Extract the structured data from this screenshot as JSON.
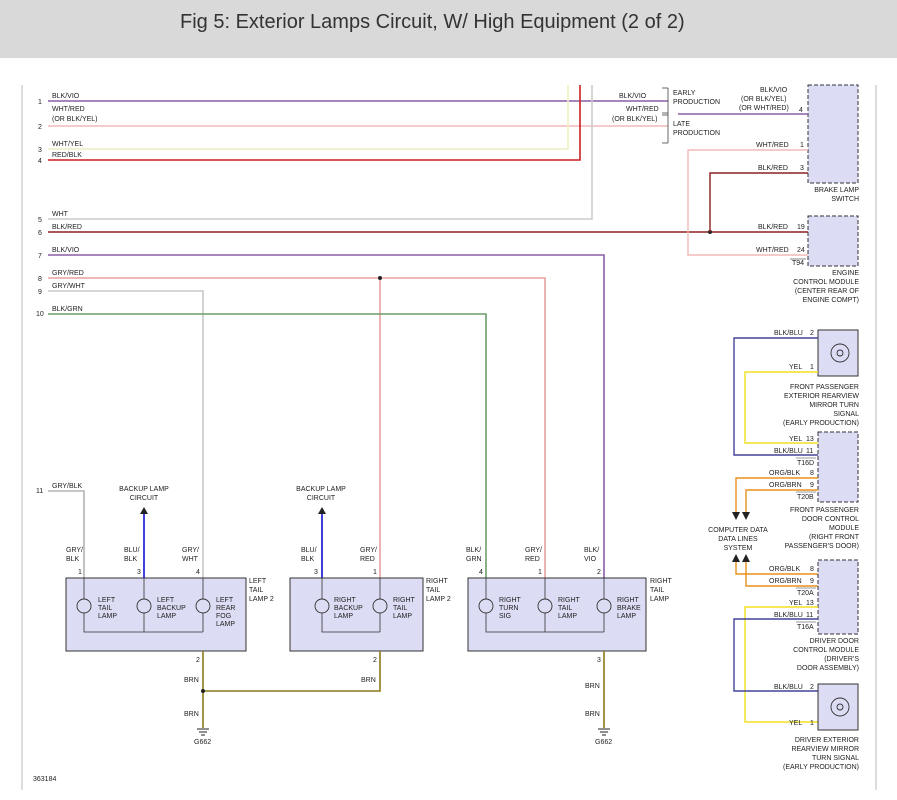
{
  "title": "Fig 5: Exterior Lamps Circuit, W/ High Equipment (2 of 2)",
  "figure_ref": "363184",
  "line_numbers": [
    "1",
    "2",
    "3",
    "4",
    "5",
    "6",
    "7",
    "8",
    "9",
    "10",
    "11"
  ],
  "wires": {
    "w1": "BLK/VIO",
    "w2a": "WHT/RED",
    "w2b": "(OR BLK/YEL)",
    "w3": "WHT/YEL",
    "w4": "RED/BLK",
    "w5": "WHT",
    "w6": "BLK/RED",
    "w7": "BLK/VIO",
    "w8": "GRY/RED",
    "w9": "GRY/WHT",
    "w10": "BLK/GRN",
    "w11": "GRY/BLK",
    "brn": "BRN"
  },
  "colors": {
    "blk_vio": "#8a5fa6",
    "wht_red": "#f2b8b8",
    "wht_yel": "#eeeec0",
    "red_blk": "#cc1f1f",
    "wht": "#cccccc",
    "blk_red": "#8b2020",
    "gry_red": "#e8a0a0",
    "gry_wht": "#c8c8c8",
    "blk_grn": "#6a9e6a",
    "gry_blk": "#b4b4b4",
    "blu_blk": "#2a2ad6",
    "brn": "#8a7a1a",
    "blk_blu": "#44449a",
    "yel": "#f0e020",
    "org": "#e8901e",
    "component_fill": "#dcdcf4"
  },
  "brake_switch": {
    "label": [
      "BRAKE LAMP",
      "SWITCH"
    ],
    "wire_a": [
      "BLK/VIO",
      "(OR BLK/YEL)",
      "(OR WHT/RED)"
    ],
    "pin_a": "4",
    "wire_b": "WHT/RED",
    "pin_b": "1",
    "wire_c": "BLK/RED",
    "pin_c": "3",
    "early": [
      "EARLY",
      "PRODUCTION"
    ],
    "late": [
      "LATE",
      "PRODUCTION"
    ],
    "early_wire": "BLK/VIO",
    "late_wire_a": "WHT/RED",
    "late_wire_b": "(OR BLK/YEL)"
  },
  "ecm": {
    "label": [
      "ENGINE",
      "CONTROL MODULE",
      "(CENTER REAR OF",
      "ENGINE COMPT)"
    ],
    "wire_a": "BLK/RED",
    "pin_a": "19",
    "wire_b": "WHT/RED",
    "pin_b": "24",
    "connector": "T94"
  },
  "fp_mirror": {
    "label": [
      "FRONT PASSENGER",
      "EXTERIOR REARVIEW",
      "MIRROR TURN",
      "SIGNAL",
      "(EARLY PRODUCTION)"
    ],
    "wire_a": "BLK/BLU",
    "pin_a": "2",
    "wire_b": "YEL",
    "pin_b": "1"
  },
  "fp_door": {
    "label": [
      "FRONT PASSENGER",
      "DOOR CONTROL",
      "MODULE",
      "(RIGHT FRONT",
      "PASSENGER'S DOOR)"
    ],
    "wire_a": "YEL",
    "pin_a": "13",
    "wire_b": "BLK/BLU",
    "pin_b": "11",
    "conn_a": "T16D",
    "wire_c": "ORG/BLK",
    "pin_c": "8",
    "wire_d": "ORG/BRN",
    "pin_d": "9",
    "conn_b": "T20B"
  },
  "data_lines": [
    "COMPUTER DATA",
    "DATA LINES",
    "SYSTEM"
  ],
  "driver_door": {
    "label": [
      "DRIVER DOOR",
      "CONTROL MODULE",
      "(DRIVER'S",
      "DOOR ASSEMBLY)"
    ],
    "wire_a": "ORG/BLK",
    "pin_a": "8",
    "wire_b": "ORG/BRN",
    "pin_b": "9",
    "conn_a": "T20A",
    "wire_c": "YEL",
    "pin_c": "13",
    "wire_d": "BLK/BLU",
    "pin_d": "11",
    "conn_b": "T16A"
  },
  "driver_mirror": {
    "label": [
      "DRIVER EXTERIOR",
      "REARVIEW MIRROR",
      "TURN SIGNAL",
      "(EARLY PRODUCTION)"
    ],
    "wire_a": "BLK/BLU",
    "pin_a": "2",
    "wire_b": "YEL",
    "pin_b": "1"
  },
  "backup_circuit": [
    "BACKUP LAMP",
    "CIRCUIT"
  ],
  "left_tail2": {
    "name": [
      "LEFT",
      "TAIL",
      "LAMP 2"
    ],
    "wire_labels": [
      [
        "GRY/",
        "BLK"
      ],
      [
        "BLU/",
        "BLK"
      ],
      [
        "GRY/",
        "WHT"
      ]
    ],
    "pins": [
      "1",
      "3",
      "4"
    ],
    "lamps": [
      [
        "LEFT",
        "TAIL",
        "LAMP"
      ],
      [
        "LEFT",
        "BACKUP",
        "LAMP"
      ],
      [
        "LEFT",
        "REAR",
        "FOG",
        "LAMP"
      ]
    ],
    "ground_pin": "2"
  },
  "right_tail2": {
    "name": [
      "RIGHT",
      "TAIL",
      "LAMP 2"
    ],
    "wire_labels": [
      [
        "BLU/",
        "BLK"
      ],
      [
        "GRY/",
        "RED"
      ]
    ],
    "pins": [
      "3",
      "1"
    ],
    "lamps": [
      [
        "RIGHT",
        "BACKUP",
        "LAMP"
      ],
      [
        "RIGHT",
        "TAIL",
        "LAMP"
      ]
    ],
    "ground_pin": "2"
  },
  "right_tail": {
    "name": [
      "RIGHT",
      "TAIL",
      "LAMP"
    ],
    "wire_labels": [
      [
        "BLK/",
        "GRN"
      ],
      [
        "GRY/",
        "RED"
      ],
      [
        "BLK/",
        "VIO"
      ]
    ],
    "pins": [
      "4",
      "1",
      "2"
    ],
    "lamps": [
      [
        "RIGHT",
        "TURN",
        "SIG"
      ],
      [
        "RIGHT",
        "TAIL",
        "LAMP"
      ],
      [
        "RIGHT",
        "BRAKE",
        "LAMP"
      ]
    ],
    "ground_pin": "3"
  },
  "ground": "G662"
}
